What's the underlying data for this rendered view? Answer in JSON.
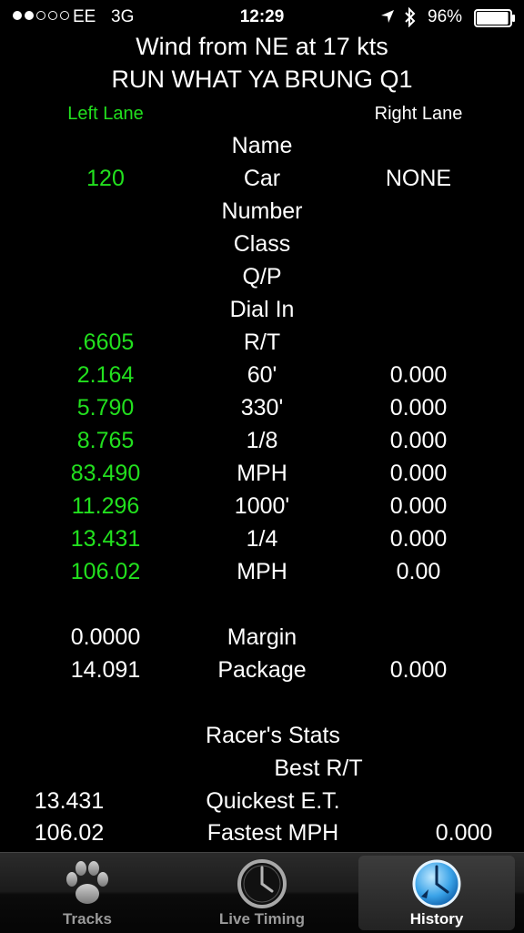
{
  "status_bar": {
    "signal_dots_full": 2,
    "signal_dots_total": 5,
    "carrier": "EE",
    "network": "3G",
    "time": "12:29",
    "battery_percent": "96%",
    "battery_level": 0.96
  },
  "header": {
    "wind": "Wind from NE at 17 kts",
    "event": "RUN WHAT YA BRUNG Q1",
    "left_lane": "Left Lane",
    "right_lane": "Right Lane"
  },
  "rows": [
    {
      "left": "",
      "mid": "Name",
      "right": ""
    },
    {
      "left": "120",
      "mid": "Car",
      "right": "NONE"
    },
    {
      "left": "",
      "mid": "Number",
      "right": ""
    },
    {
      "left": "",
      "mid": "Class",
      "right": ""
    },
    {
      "left": "",
      "mid": "Q/P",
      "right": ""
    },
    {
      "left": "",
      "mid": "Dial In",
      "right": ""
    },
    {
      "left": ".6605",
      "mid": "R/T",
      "right": ""
    },
    {
      "left": "2.164",
      "mid": "60'",
      "right": "0.000"
    },
    {
      "left": "5.790",
      "mid": "330'",
      "right": "0.000"
    },
    {
      "left": "8.765",
      "mid": "1/8",
      "right": "0.000"
    },
    {
      "left": "83.490",
      "mid": "MPH",
      "right": "0.000"
    },
    {
      "left": "11.296",
      "mid": "1000'",
      "right": "0.000"
    },
    {
      "left": "13.431",
      "mid": "1/4",
      "right": "0.000"
    },
    {
      "left": "106.02",
      "mid": "MPH",
      "right": "0.00"
    }
  ],
  "summary": {
    "margin_left": "0.0000",
    "margin_label": "Margin",
    "package_left": "14.091",
    "package_label": "Package",
    "package_right": "0.000"
  },
  "stats": {
    "title": "Racer's Stats",
    "best_rt_label": "Best R/T",
    "quickest_left": "13.431",
    "quickest_label": "Quickest E.T.",
    "fastest_left": "106.02",
    "fastest_label": "Fastest MPH",
    "fastest_right": "0.000"
  },
  "tab_bar": {
    "tabs": [
      {
        "label": "Tracks",
        "icon": "paw-icon",
        "active": false
      },
      {
        "label": "Live Timing",
        "icon": "clock-icon",
        "active": false
      },
      {
        "label": "History",
        "icon": "history-clock-icon",
        "active": true
      }
    ]
  },
  "colors": {
    "background": "#000000",
    "left_lane_green": "#22e01e",
    "text": "#ffffff",
    "tab_inactive": "#9a9a9a"
  }
}
